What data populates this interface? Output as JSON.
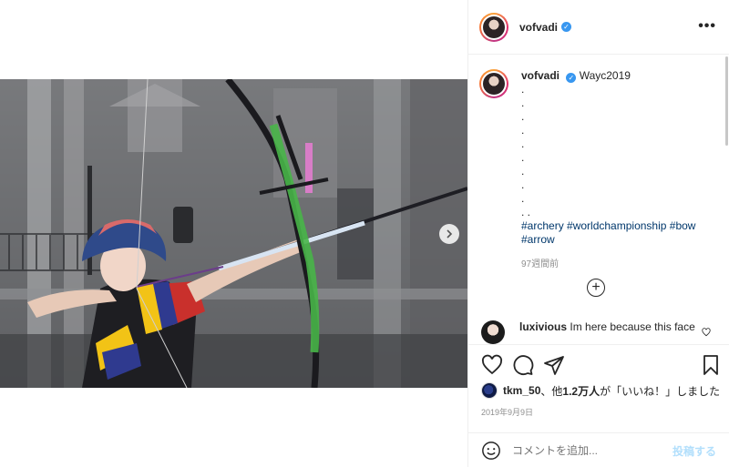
{
  "post": {
    "username": "vofvadi",
    "caption_text": "Wayc2019",
    "caption_dots": [
      ".",
      ".",
      ".",
      ".",
      ".",
      ".",
      ".",
      ".",
      ".",
      ". ."
    ],
    "hashtags": [
      "#archery",
      "#worldchampionship",
      "#bow",
      "#arrow"
    ],
    "time_ago": "97週間前",
    "date": "2019年9月9日"
  },
  "comment": {
    "username": "luxivious",
    "text": "Im here because this face"
  },
  "likes": {
    "liker": "tkm_50",
    "middle": "、他",
    "count": "1.2万人",
    "suffix": "が「いいね！」しました"
  },
  "add_comment": {
    "placeholder": "コメントを追加...",
    "post_label": "投稿する"
  },
  "icons": {
    "more": "more-options-icon",
    "next": "chevron-right-icon",
    "plus": "plus-circle-icon",
    "heart": "heart-icon",
    "comment": "comment-icon",
    "share": "paper-plane-icon",
    "save": "bookmark-icon",
    "emoji": "emoji-icon",
    "verified": "verified-badge-icon"
  },
  "colors": {
    "verified": "#3897f0",
    "hashtag": "#00376b",
    "muted": "#8e8e8e",
    "post_button": "#b2dffc"
  }
}
